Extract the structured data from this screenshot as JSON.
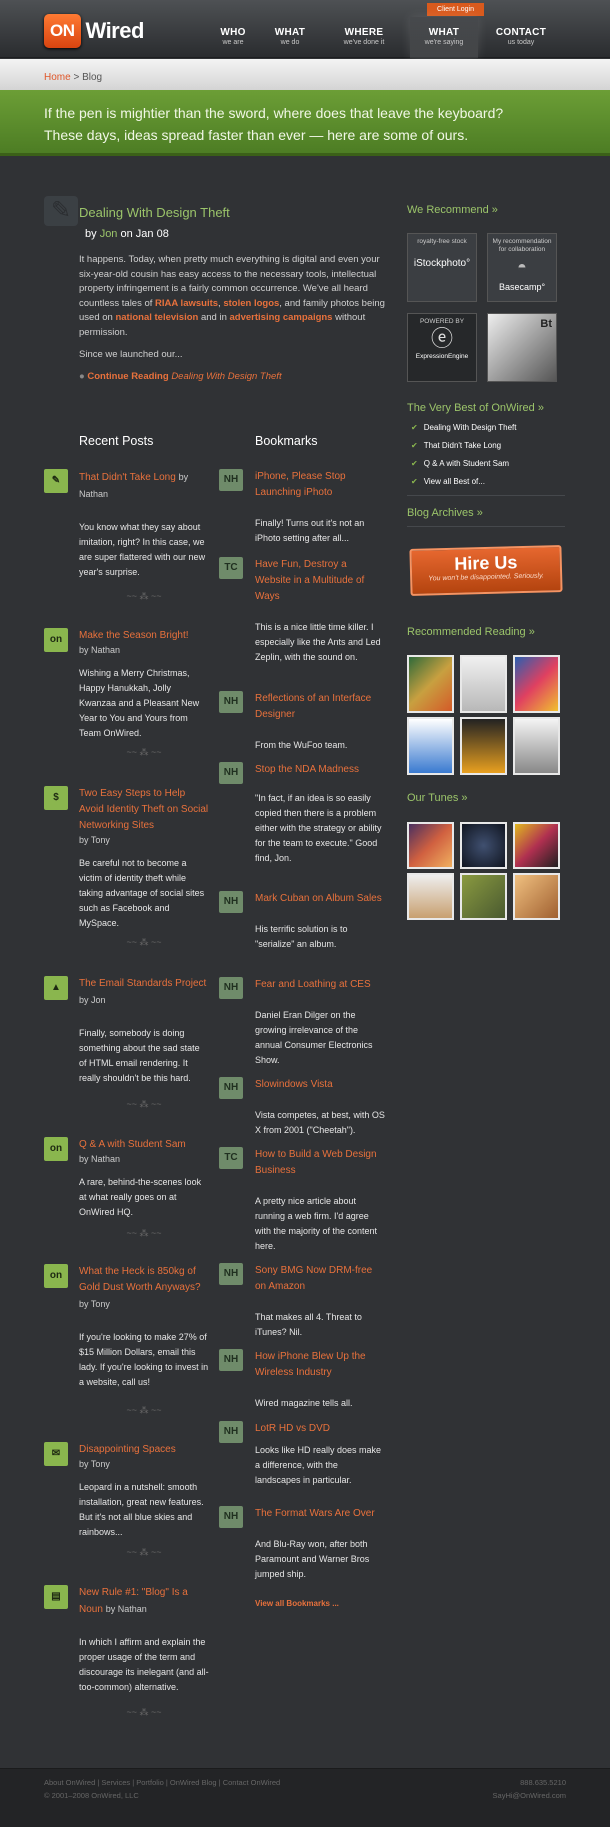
{
  "header": {
    "logo_on": "ON",
    "logo_wired": "Wired",
    "client_login": "Client Login",
    "nav": [
      {
        "title": "WHO",
        "sub": "we are"
      },
      {
        "title": "WHAT",
        "sub": "we do"
      },
      {
        "title": "WHERE",
        "sub": "we've done it"
      },
      {
        "title": "WHAT",
        "sub": "we're saying"
      },
      {
        "title": "CONTACT",
        "sub": "us today"
      }
    ]
  },
  "breadcrumb": {
    "home": "Home",
    "sep": ">",
    "current": "Blog"
  },
  "banner": {
    "line1": "If the pen is mightier than the sword, where does that leave the keyboard?",
    "line2": "These days, ideas spread faster than ever — here are some of ours."
  },
  "featured": {
    "title": "Dealing With Design Theft",
    "by": "by",
    "author": "Jon",
    "on": "on Jan 08",
    "body_1": "It happens. Today, when pretty much everything is digital and even your six-year-old cousin has easy access to the necessary tools, intellectual property infringement is a fairly common occurrence. We've all heard countless tales of ",
    "link_1": "RIAA lawsuits",
    "body_2": ", ",
    "link_2": "stolen logos",
    "body_3": ", and family photos being used on ",
    "link_3": "national television",
    "body_4": " and in ",
    "link_4": "advertising campaigns",
    "body_5": " without permission.",
    "since": "Since we launched our...",
    "continue_bold": "Continue Reading",
    "continue_italic": "Dealing With Design Theft"
  },
  "recent_posts": {
    "heading": "Recent Posts",
    "items": [
      {
        "icon": "✎",
        "title": "That Didn't Take Long",
        "by": "by Nathan",
        "body": "You know what they say about imitation, right? In this case, we are super flattered with our new year's surprise."
      },
      {
        "icon": "on",
        "title": "Make the Season Bright!",
        "by": "by Nathan",
        "body": "Wishing a Merry Christmas, Happy Hanukkah, Jolly Kwanzaa and a Pleasant New Year to You and Yours from Team OnWired."
      },
      {
        "icon": "$",
        "title": "Two Easy Steps to Help Avoid Identity Theft on Social Networking Sites",
        "by": "by Tony",
        "body": "Be careful not to become a victim of identity theft while taking advantage of social sites such as Facebook and MySpace."
      },
      {
        "icon": "▲",
        "title": "The Email Standards Project",
        "by": "by Jon",
        "body": "Finally, somebody is doing something about the sad state of HTML email rendering. It really shouldn't be this hard."
      },
      {
        "icon": "on",
        "title": "Q & A with Student Sam",
        "by": "by Nathan",
        "body": "A rare, behind-the-scenes look at what really goes on at OnWired HQ."
      },
      {
        "icon": "on",
        "title": "What the Heck is 850kg of Gold Dust Worth Anyways?",
        "by": "by Tony",
        "body": "If you're looking to make 27% of $15 Million Dollars, email this lady. If you're looking to invest in a website, call us!"
      },
      {
        "icon": "✉",
        "title": "Disappointing Spaces",
        "by": "by Tony",
        "body": "Leopard in a nutshell: smooth installation, great new features. But it's not all blue skies and rainbows..."
      },
      {
        "icon": "▤",
        "title": "New Rule #1: \"Blog\" Is a Noun",
        "by": "by Nathan",
        "body": "In which I affirm and explain the proper usage of the term and discourage its inelegant (and all-too-common) alternative."
      }
    ]
  },
  "bookmarks": {
    "heading": "Bookmarks",
    "view_all": "View all Bookmarks ...",
    "items": [
      {
        "icon": "NH",
        "title": "iPhone, Please Stop Launching iPhoto",
        "body": "Finally! Turns out it's not an iPhoto setting after all..."
      },
      {
        "icon": "TC",
        "title": "Have Fun, Destroy a Website in a Multitude of Ways",
        "body": "This is a nice little time killer. I especially like the Ants and Led Zeplin, with the sound on."
      },
      {
        "icon": "NH",
        "title": "Reflections of an Interface Designer",
        "body": "From the WuFoo team."
      },
      {
        "icon": "NH",
        "title": "Stop the NDA Madness",
        "body": "\"In fact, if an idea is so easily copied then there is a problem either with the strategy or ability for the team to execute.\" Good find, Jon."
      },
      {
        "icon": "NH",
        "title": "Mark Cuban on Album Sales",
        "body": "His terrific solution is to \"serialize\" an album."
      },
      {
        "icon": "NH",
        "title": "Fear and Loathing at CES",
        "body": "Daniel Eran Dilger on the growing irrelevance of the annual Consumer Electronics Show."
      },
      {
        "icon": "NH",
        "title": "Slowindows Vista",
        "body": "Vista competes, at best, with OS X from 2001 (\"Cheetah\")."
      },
      {
        "icon": "TC",
        "title": "How to Build a Web Design Business",
        "body": "A pretty nice article about running a web firm. I'd agree with the majority of the content here."
      },
      {
        "icon": "NH",
        "title": "Sony BMG Now DRM-free on Amazon",
        "body": "That makes all 4. Threat to iTunes? Nil."
      },
      {
        "icon": "NH",
        "title": "How iPhone Blew Up the Wireless Industry",
        "body": "Wired magazine tells all."
      },
      {
        "icon": "NH",
        "title": "LotR HD vs DVD",
        "body": "Looks like HD really does make a difference, with the landscapes in particular."
      },
      {
        "icon": "NH",
        "title": "The Format Wars Are Over",
        "body": "And Blu-Ray won, after both Paramount and Warner Bros jumped ship."
      }
    ]
  },
  "sidebar": {
    "recommend_heading": "We Recommend",
    "rec_istock_cap": "royalty-free stock",
    "rec_istock_logo": "iStockphoto°",
    "rec_basecamp_cap": "My recommendation for collaboration",
    "rec_basecamp_logo": "Basecamp°",
    "rec_ee_cap": "POWERED BY",
    "rec_ee_logo": "ExpressionEngine",
    "rec_photo_text": "Bt",
    "best_heading": "The Very Best of OnWired",
    "best_items": [
      "Dealing With Design Theft",
      "That Didn't Take Long",
      "Q & A with Student Sam",
      "View all Best of..."
    ],
    "archives_heading": "Blog Archives",
    "hire_title": "Hire Us",
    "hire_sub": "You won't be disappointed. Seriously.",
    "reading_heading": "Recommended Reading",
    "tunes_heading": "Our Tunes"
  },
  "footer": {
    "links": "About OnWired | Services | Portfolio | OnWired Blog | Contact OnWired",
    "copyright": "© 2001–2008 OnWired, LLC",
    "phone": "888.635.5210",
    "email": "SayHi@OnWired.com"
  },
  "colors": {
    "accent_orange": "#e8713c",
    "accent_green": "#9bc46a",
    "background": "#303235"
  }
}
